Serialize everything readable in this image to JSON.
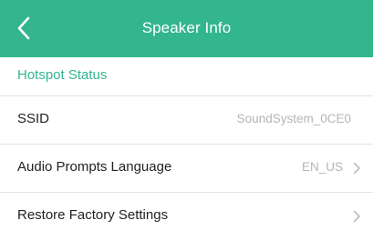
{
  "header": {
    "title": "Speaker Info",
    "back_icon": "chevron-left-icon",
    "color": "#33b58e"
  },
  "section": {
    "title": "Hotspot Status"
  },
  "rows": [
    {
      "label": "SSID",
      "value": "SoundSystem_0CE0",
      "has_chevron": false
    },
    {
      "label": "Audio Prompts Language",
      "value": "EN_US",
      "has_chevron": true,
      "icon": "chevron-right-icon"
    },
    {
      "label": "Restore Factory Settings",
      "value": "",
      "has_chevron": true,
      "icon": "chevron-right-icon"
    }
  ]
}
